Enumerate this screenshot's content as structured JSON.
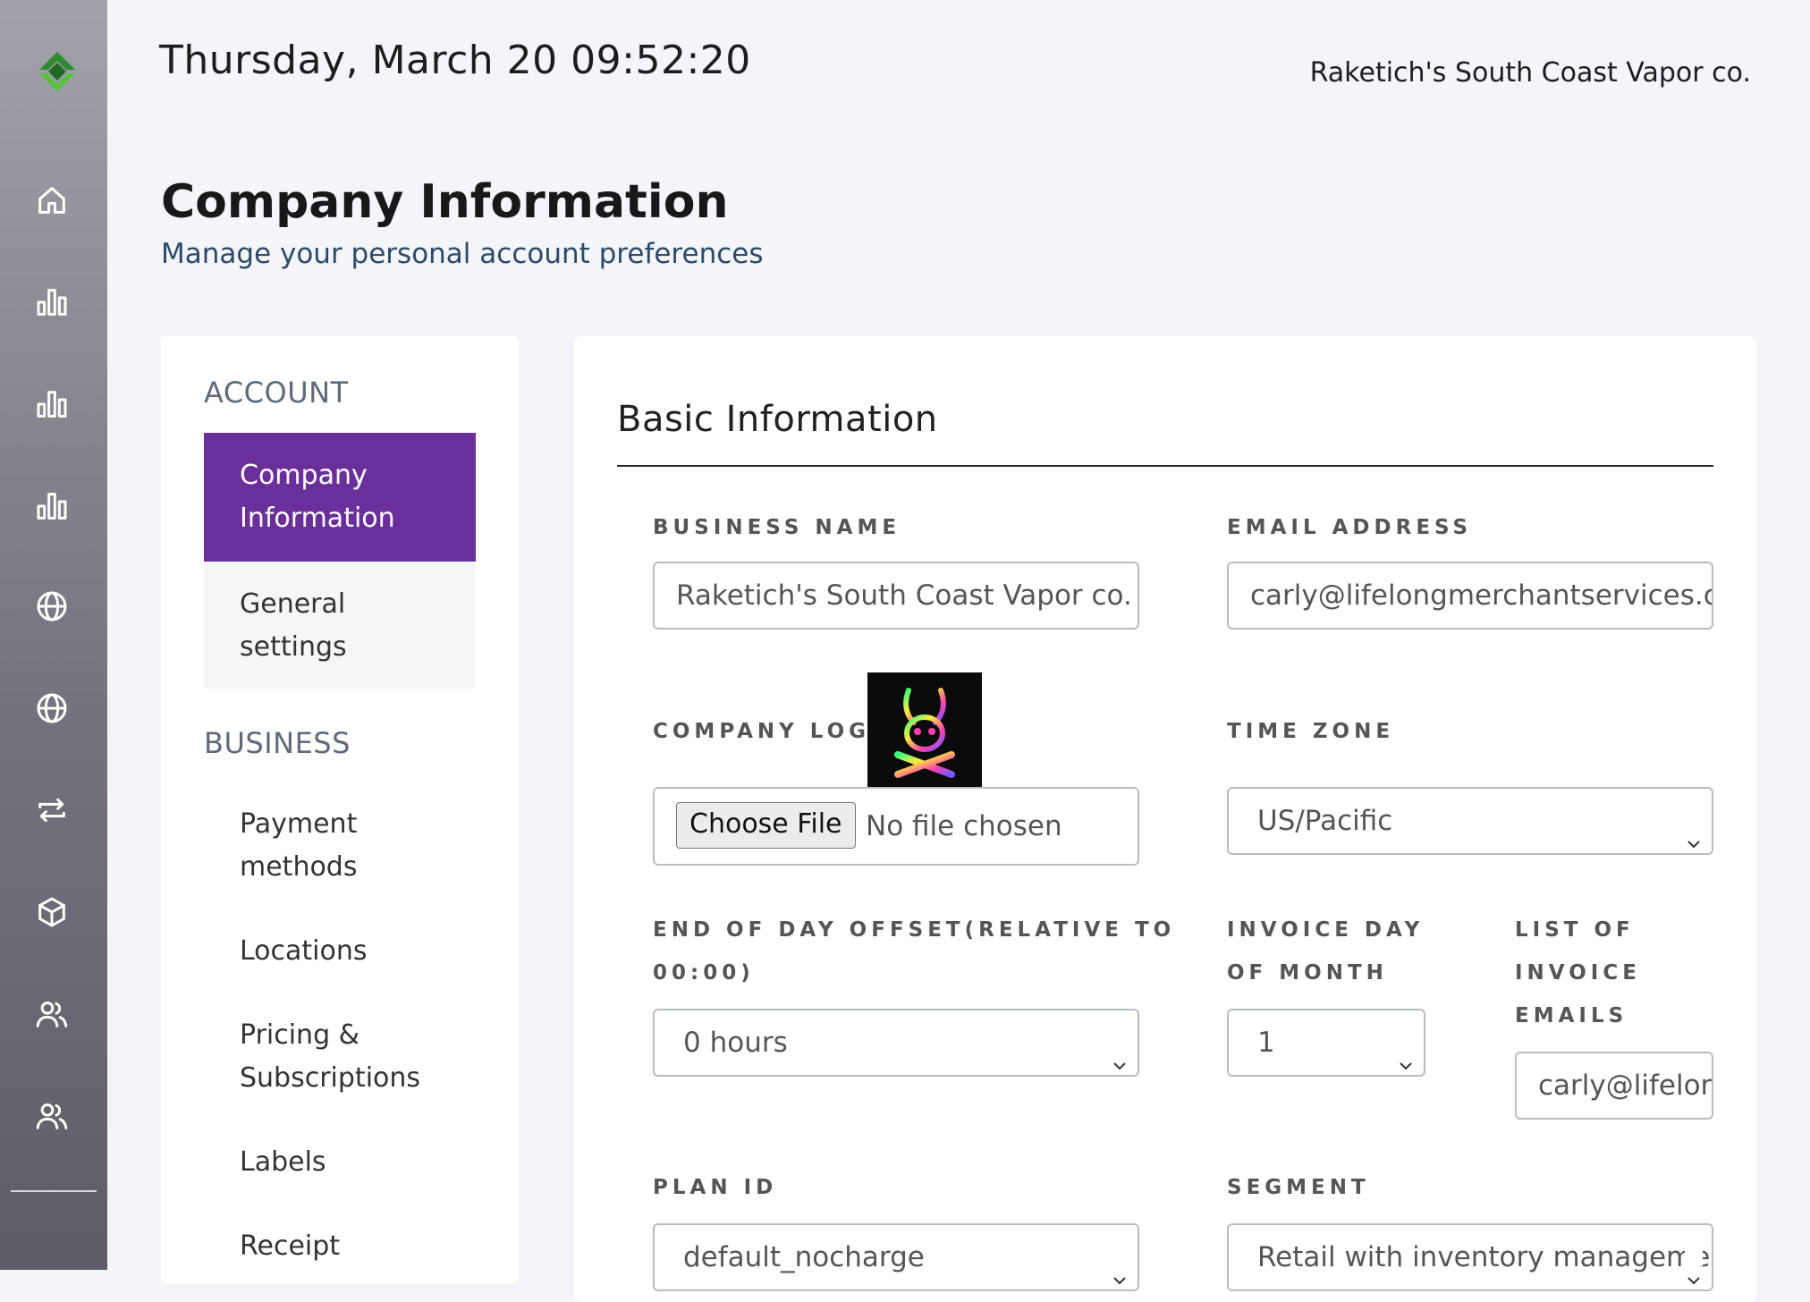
{
  "header": {
    "datetime": "Thursday, March 20 09:52:20",
    "company_name": "Raketich's South Coast Vapor co."
  },
  "page": {
    "title": "Company Information",
    "subtitle": "Manage your personal account preferences"
  },
  "sidebar": {
    "icons": [
      "home-icon",
      "bar-chart-icon",
      "bar-chart-icon",
      "bar-chart-icon",
      "globe-icon",
      "globe-icon",
      "transfer-icon",
      "box-icon",
      "users-icon",
      "users-icon"
    ]
  },
  "settings_nav": {
    "account_heading": "ACCOUNT",
    "business_heading": "BUSINESS",
    "items": [
      {
        "label_1": "Company",
        "label_2": "Information"
      },
      {
        "label_1": "General",
        "label_2": "settings"
      },
      {
        "label_1": "Payment",
        "label_2": "methods"
      },
      {
        "label_1": "Locations"
      },
      {
        "label_1": "Pricing &",
        "label_2": "Subscriptions"
      },
      {
        "label_1": "Labels"
      },
      {
        "label_1": "Receipt"
      }
    ]
  },
  "card": {
    "title": "Basic Information",
    "business_name": {
      "label": "BUSINESS NAME",
      "value": "Raketich's South Coast Vapor co."
    },
    "email_address": {
      "label": "EMAIL ADDRESS",
      "value": "carly@lifelongmerchantservices.com"
    },
    "company_logo": {
      "label": "COMPANY LOGO",
      "button": "Choose File",
      "status": "No file chosen"
    },
    "time_zone": {
      "label": "TIME ZONE",
      "value": "US/Pacific"
    },
    "end_of_day_offset": {
      "label_1": "END OF DAY OFFSET(RELATIVE TO",
      "label_2": "00:00)",
      "value": "0 hours"
    },
    "invoice_day": {
      "label_1": "INVOICE DAY",
      "label_2": "OF MONTH",
      "value": "1"
    },
    "invoice_emails": {
      "label_1": "LIST OF",
      "label_2": "INVOICE",
      "label_3": "EMAILS",
      "value": "carly@lifelongmerchantservices.com"
    },
    "plan_id": {
      "label": "PLAN ID",
      "value": "default_nocharge"
    },
    "segment": {
      "label": "SEGMENT",
      "value": "Retail with inventory management"
    }
  }
}
